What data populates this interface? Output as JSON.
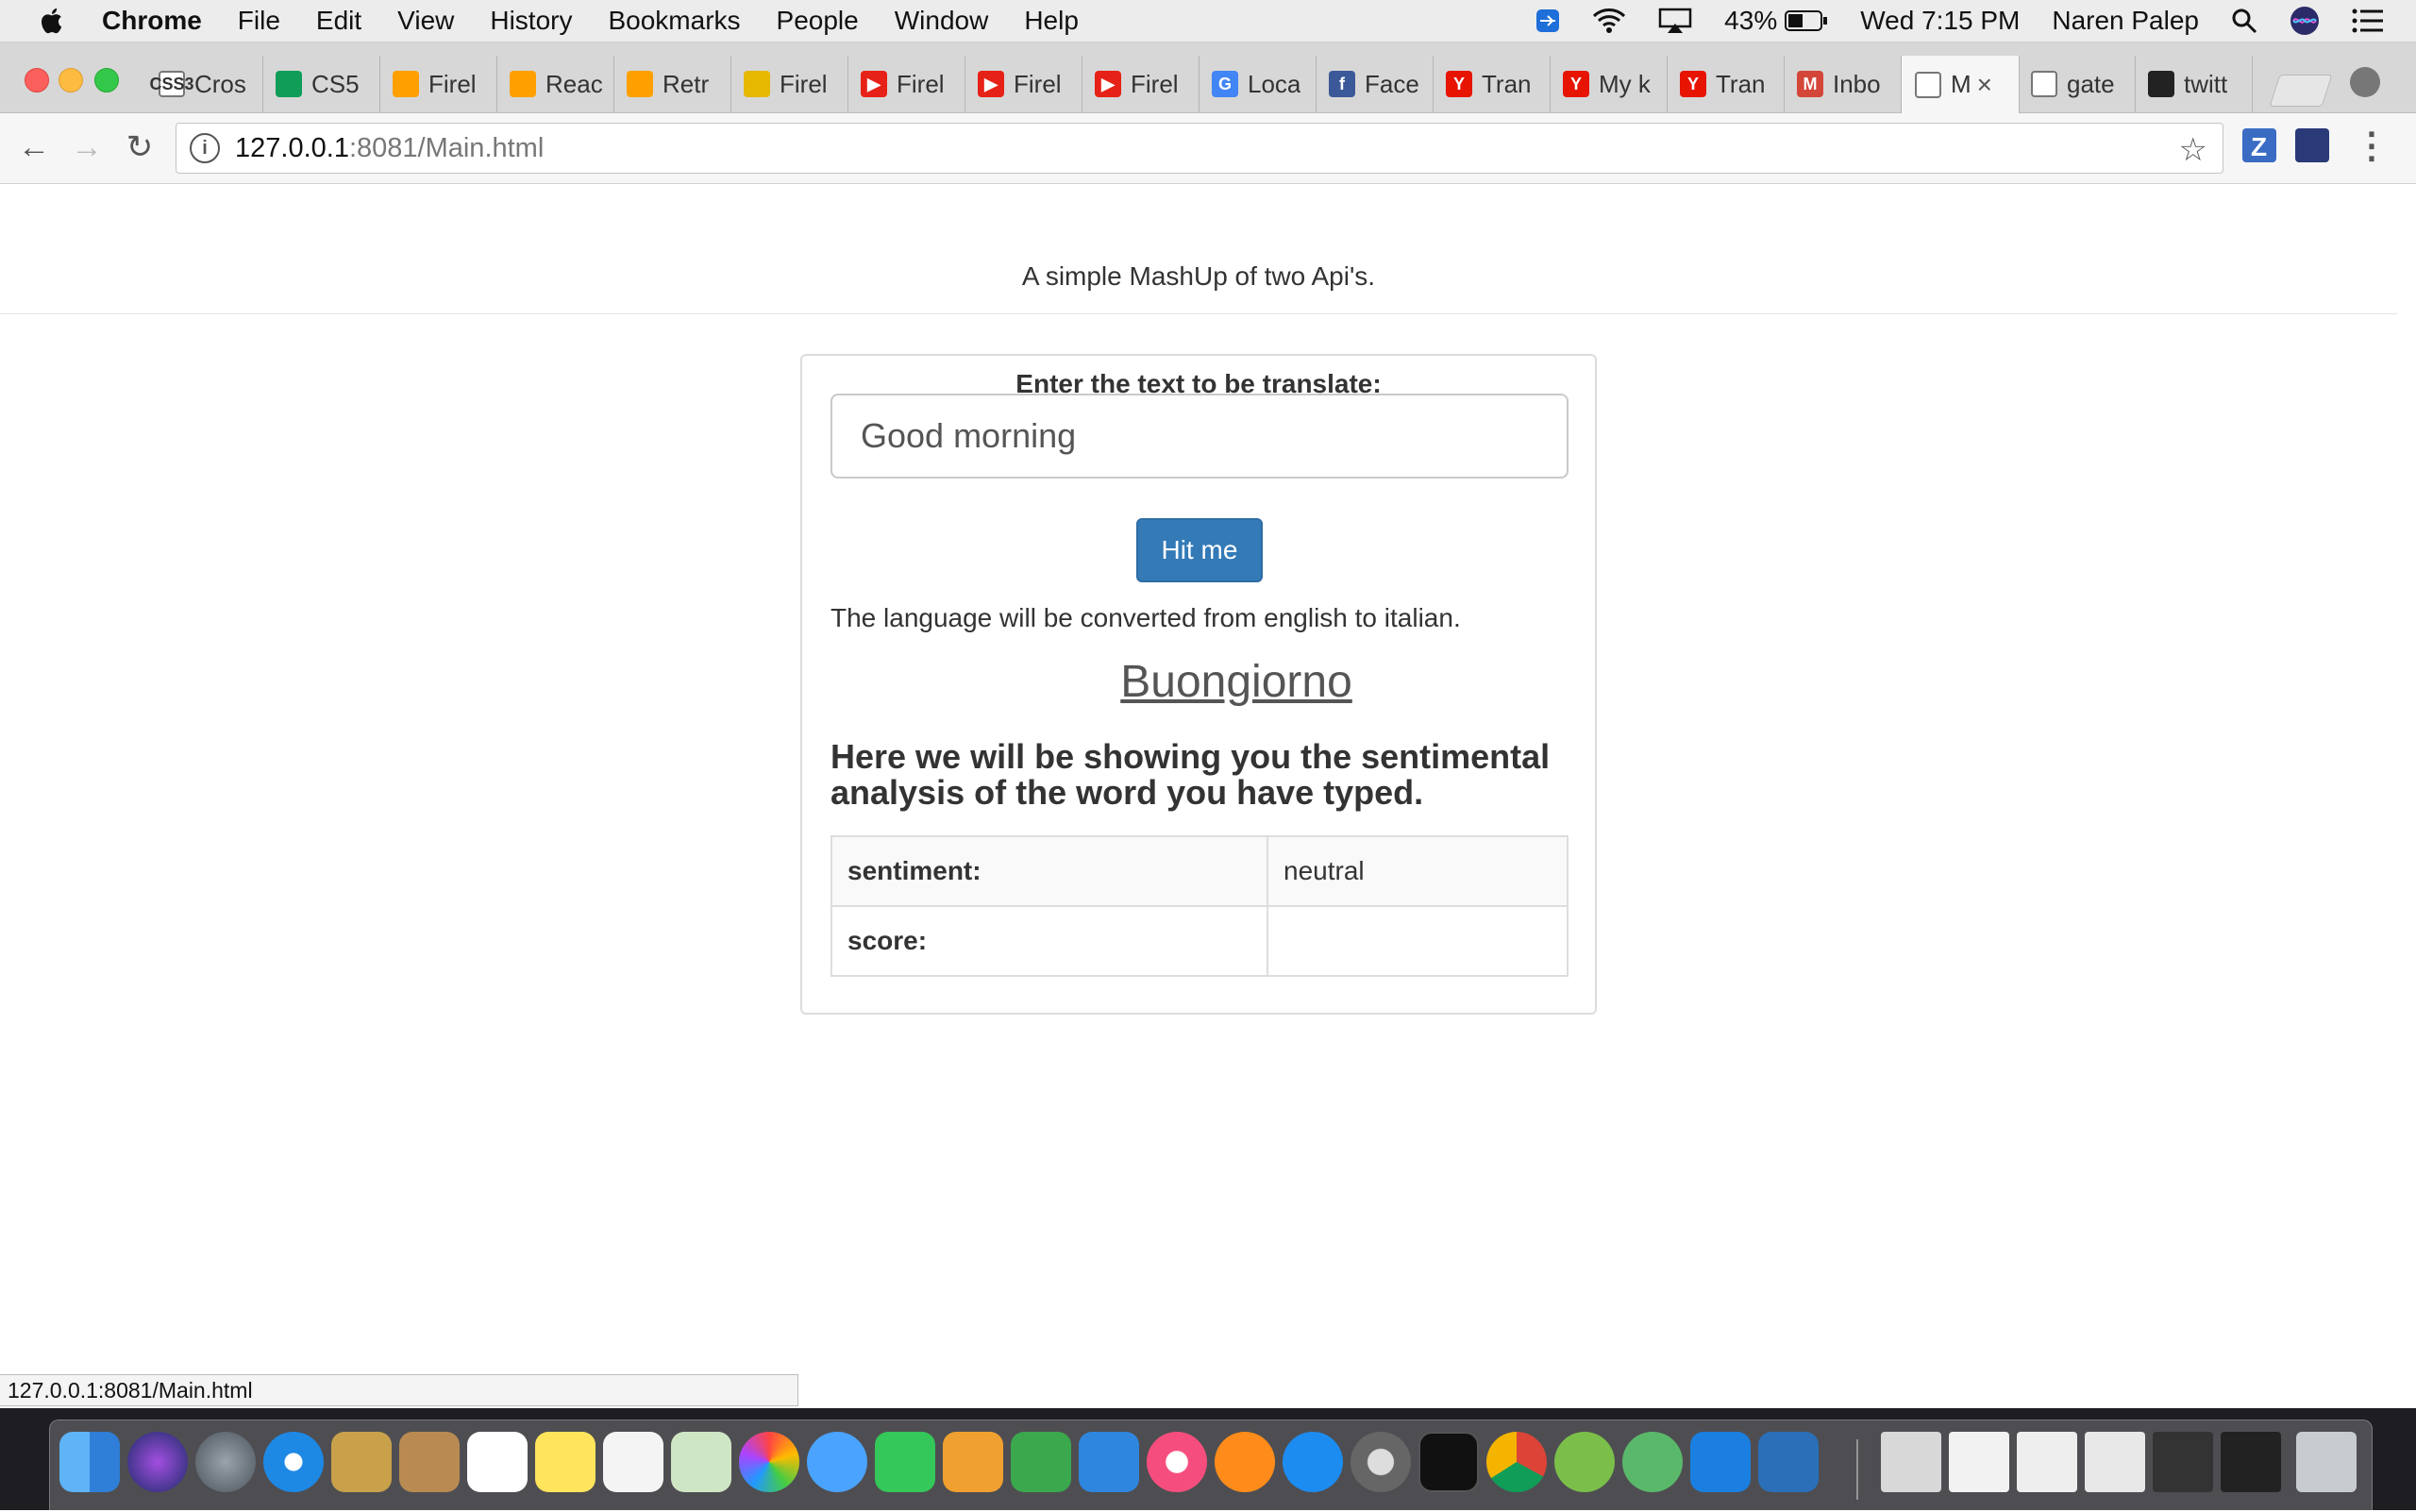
{
  "menubar": {
    "app_name": "Chrome",
    "items": [
      "File",
      "Edit",
      "View",
      "History",
      "Bookmarks",
      "People",
      "Window",
      "Help"
    ],
    "battery": "43%",
    "clock": "Wed 7:15 PM",
    "user": "Naren Palep"
  },
  "tabs": [
    {
      "label": "Cros",
      "icon": "css3-icon",
      "icon_text": "CSS3",
      "icon_color": "#ffffff"
    },
    {
      "label": "CS5",
      "icon": "sheets-icon",
      "icon_text": "",
      "icon_color": "#0f9d58"
    },
    {
      "label": "Firel",
      "icon": "firebase-icon",
      "icon_text": "",
      "icon_color": "#ffa000"
    },
    {
      "label": "Reac",
      "icon": "firebase-icon",
      "icon_text": "",
      "icon_color": "#ffa000"
    },
    {
      "label": "Retr",
      "icon": "firebase-icon",
      "icon_text": "",
      "icon_color": "#ffa000"
    },
    {
      "label": "Firel",
      "icon": "database-icon",
      "icon_text": "",
      "icon_color": "#e6b800"
    },
    {
      "label": "Firel",
      "icon": "youtube-icon",
      "icon_text": "▶",
      "icon_color": "#e62117"
    },
    {
      "label": "Firel",
      "icon": "youtube-icon",
      "icon_text": "▶",
      "icon_color": "#e62117"
    },
    {
      "label": "Firel",
      "icon": "youtube-icon",
      "icon_text": "▶",
      "icon_color": "#e62117"
    },
    {
      "label": "Loca",
      "icon": "google-icon",
      "icon_text": "G",
      "icon_color": "#4285f4"
    },
    {
      "label": "Face",
      "icon": "facebook-icon",
      "icon_text": "f",
      "icon_color": "#3b5998"
    },
    {
      "label": "Tran",
      "icon": "yandex-icon",
      "icon_text": "Y",
      "icon_color": "#e61400"
    },
    {
      "label": "My k",
      "icon": "yandex-icon",
      "icon_text": "Y",
      "icon_color": "#e61400"
    },
    {
      "label": "Tran",
      "icon": "yandex-icon",
      "icon_text": "Y",
      "icon_color": "#e61400"
    },
    {
      "label": "Inbo",
      "icon": "gmail-icon",
      "icon_text": "M",
      "icon_color": "#d44638"
    },
    {
      "label": "M",
      "icon": "page-icon",
      "icon_text": "",
      "icon_color": "#ffffff",
      "active": true
    },
    {
      "label": "gate",
      "icon": "page-icon",
      "icon_text": "",
      "icon_color": "#ffffff"
    },
    {
      "label": "twitt",
      "icon": "github-icon",
      "icon_text": "",
      "icon_color": "#222222"
    }
  ],
  "toolbar": {
    "url_host": "127.0.0.1",
    "url_rest": ":8081/Main.html"
  },
  "page": {
    "subtitle": "A simple MashUp of two Api's.",
    "input_label": "Enter the text to be translate:",
    "input_value": "Good morning",
    "button_label": "Hit me",
    "conversion_note": "The language will be converted from english to italian.",
    "translation": "Buongiorno",
    "analysis_heading": "Here we will be showing you the sentimental analysis of the word you have typed.",
    "table": [
      {
        "key": "sentiment:",
        "value": "neutral"
      },
      {
        "key": "score:",
        "value": ""
      }
    ]
  },
  "status_url": "127.0.0.1:8081/Main.html",
  "colors": {
    "primary_button": "#337ab7",
    "tab_strip": "#d7d7d7"
  }
}
